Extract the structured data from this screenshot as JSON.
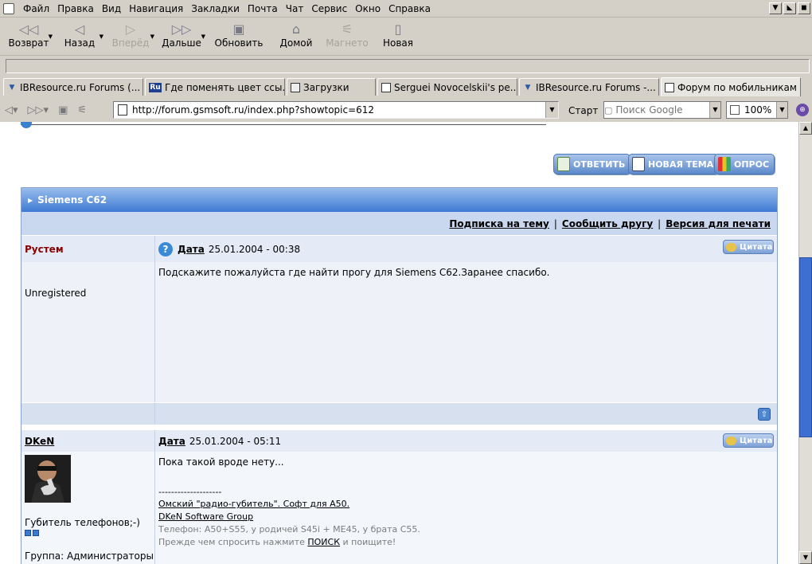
{
  "menu": [
    "Файл",
    "Правка",
    "Вид",
    "Навигация",
    "Закладки",
    "Почта",
    "Чат",
    "Сервис",
    "Окно",
    "Справка"
  ],
  "toolbar": {
    "back": "Возврат",
    "prev": "Назад",
    "forward": "Вперёд",
    "next": "Дальше",
    "reload": "Обновить",
    "home": "Домой",
    "magic": "Магнето",
    "new": "Новая"
  },
  "tabs": [
    {
      "label": "IBResource.ru Forums (..."
    },
    {
      "label": "Где поменять цвет ссы..."
    },
    {
      "label": "Загрузки"
    },
    {
      "label": "Serguei Novocelskii's pe..."
    },
    {
      "label": "IBResource.ru Forums -..."
    },
    {
      "label": "Форум по мобильникам ..."
    }
  ],
  "address": {
    "url": "http://forum.gsmsoft.ru/index.php?showtopic=612",
    "start_label": "Старт",
    "search_placeholder": "Поиск Google",
    "zoom": "100%"
  },
  "actions": {
    "reply": "ОТВЕТИТЬ",
    "new_topic": "НОВАЯ ТЕМА",
    "poll": "ОПРОС"
  },
  "topic": {
    "title": "Siemens C62",
    "subscribe": "Подписка на тему",
    "tell_friend": "Сообщить другу",
    "print": "Версия для печати",
    "separator": "|"
  },
  "posts": [
    {
      "author": "Рустем",
      "date_label": "Дата",
      "date": "25.01.2004 - 00:38",
      "quote_label": "Цитата",
      "group": "Unregistered",
      "text": "Подскажите пожалуйста где найти прогу для Siemens C62.Заранее спасибо."
    },
    {
      "author": "DKeN",
      "date_label": "Дата",
      "date": "25.01.2004 - 05:11",
      "quote_label": "Цитата",
      "title": "Губитель телефонов;-)",
      "group": "Группа: Администраторы",
      "text": "Пока такой вроде нету...",
      "sig_divider": "--------------------",
      "sig_link1": "Омский \"радио-губитель\". Софт для A50.",
      "sig_link2": "DKeN Software Group",
      "sig_phone": "Телефон: A50+S55, у родичей S45i + ME45, у брата C55.",
      "sig_search_prefix": "Прежде чем спросить нажмите",
      "sig_search_link": "ПОИСК",
      "sig_search_suffix": "и поищите!"
    }
  ]
}
